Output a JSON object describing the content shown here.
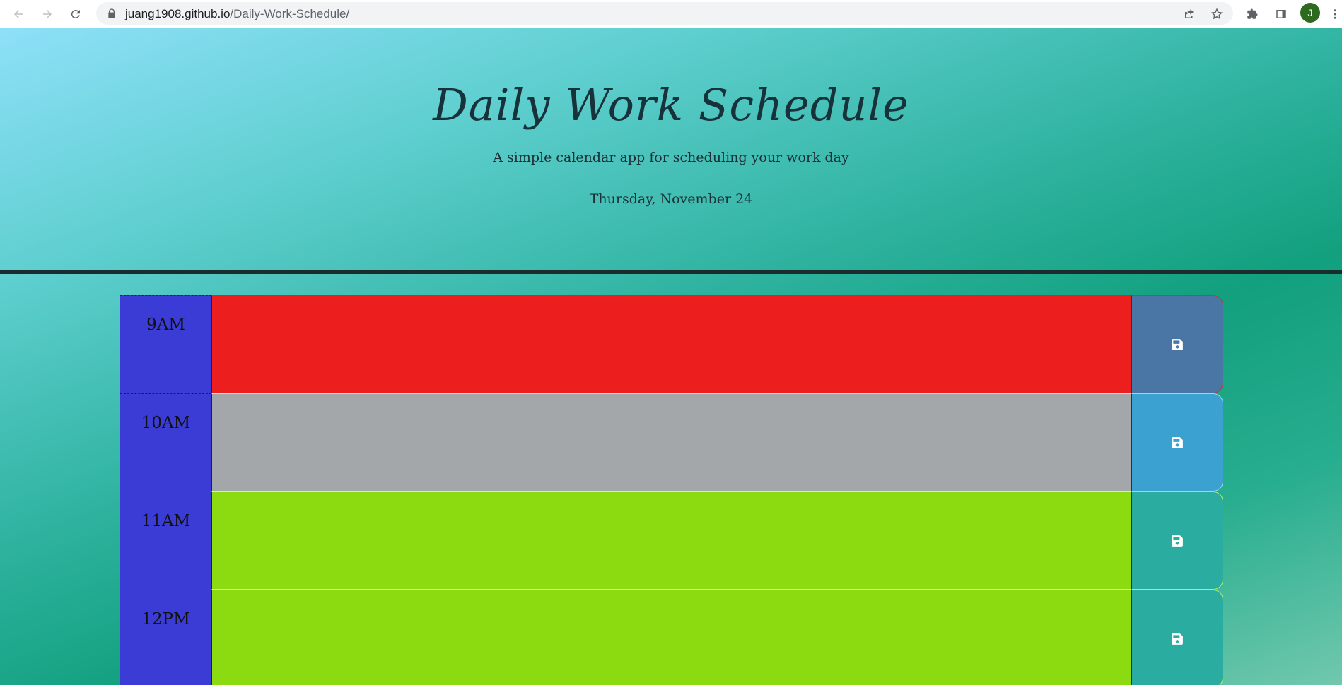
{
  "browser": {
    "url_host": "juang1908.github.io",
    "url_path": "/Daily-Work-Schedule/",
    "avatar_letter": "J"
  },
  "header": {
    "title": "Daily Work Schedule",
    "lead": "A simple calendar app for scheduling your work day",
    "current_day": "Thursday, November 24"
  },
  "schedule": {
    "rows": [
      {
        "hour": "9AM",
        "state": "past",
        "text": ""
      },
      {
        "hour": "10AM",
        "state": "present",
        "text": ""
      },
      {
        "hour": "11AM",
        "state": "future",
        "text": ""
      },
      {
        "hour": "12PM",
        "state": "future",
        "text": ""
      }
    ]
  },
  "colors": {
    "past": "#ed1e1e",
    "present": "#a3a7aa",
    "future": "#8cdb10",
    "hour_block": "#3b3bd6"
  }
}
